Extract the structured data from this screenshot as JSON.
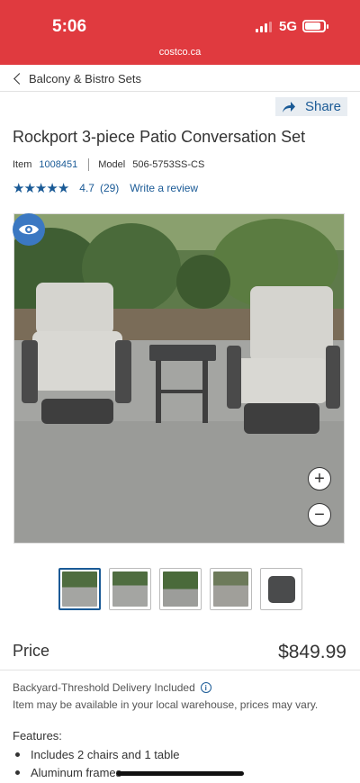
{
  "status_bar": {
    "time": "5:06",
    "network": "5G"
  },
  "browser": {
    "url": "costco.ca"
  },
  "breadcrumb": {
    "label": "Balcony & Bistro Sets"
  },
  "share": {
    "label": "Share"
  },
  "product": {
    "title": "Rockport 3-piece Patio Conversation Set",
    "item_label": "Item",
    "item_number": "1008451",
    "model_label": "Model",
    "model_number": "506-5753SS-CS",
    "rating_value": "4.7",
    "rating_count": "(29)",
    "stars": 4.7,
    "write_review": "Write a review"
  },
  "gallery": {
    "thumbnails": [
      {
        "alt": "set"
      },
      {
        "alt": "chair side"
      },
      {
        "alt": "chair angle"
      },
      {
        "alt": "table"
      },
      {
        "alt": "table top"
      }
    ],
    "active_index": 0
  },
  "pricing": {
    "label": "Price",
    "value": "$849.99"
  },
  "delivery": {
    "text": "Backyard-Threshold Delivery Included",
    "note": "Item may be available in your local warehouse, prices may vary."
  },
  "features": {
    "label": "Features:",
    "items": [
      "Includes 2 chairs and 1 table",
      "Aluminum frames"
    ]
  },
  "colors": {
    "brand_red": "#e03a3f",
    "link_blue": "#1a5a96",
    "eye_blue": "#3b78c2"
  },
  "icons": [
    "chevron-left-icon",
    "share-icon",
    "star-icon",
    "eye-icon",
    "plus-icon",
    "minus-icon",
    "info-icon"
  ]
}
